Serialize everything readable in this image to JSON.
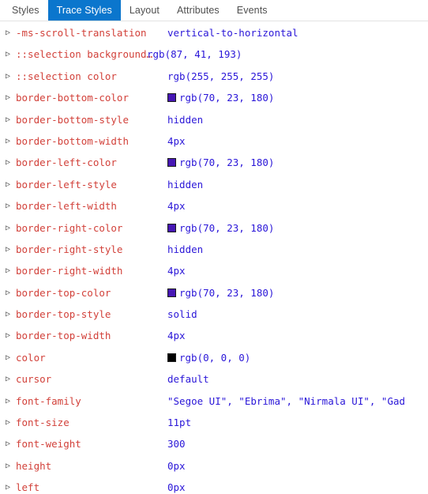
{
  "tabs": [
    {
      "label": "Styles",
      "active": false
    },
    {
      "label": "Trace Styles",
      "active": true
    },
    {
      "label": "Layout",
      "active": false
    },
    {
      "label": "Attributes",
      "active": false
    },
    {
      "label": "Events",
      "active": false
    }
  ],
  "colors": {
    "accent": "#0b76cd",
    "property_name": "#d2413a",
    "property_value": "#2a16d8",
    "tab_text": "#4f4f4f",
    "separator": "#e3e3e3"
  },
  "expander_glyph": "▷",
  "properties": [
    {
      "name": "-ms-scroll-translation",
      "value": "vertical-to-horizontal",
      "swatch": null,
      "name_truncated": false
    },
    {
      "name": "::selection background…",
      "value": "rgb(87, 41, 193)",
      "swatch": null,
      "name_truncated": true
    },
    {
      "name": "::selection color",
      "value": "rgb(255, 255, 255)",
      "swatch": null,
      "name_truncated": false
    },
    {
      "name": "border-bottom-color",
      "value": "rgb(70, 23, 180)",
      "swatch": "#4617b4",
      "name_truncated": false
    },
    {
      "name": "border-bottom-style",
      "value": "hidden",
      "swatch": null,
      "name_truncated": false
    },
    {
      "name": "border-bottom-width",
      "value": "4px",
      "swatch": null,
      "name_truncated": false
    },
    {
      "name": "border-left-color",
      "value": "rgb(70, 23, 180)",
      "swatch": "#4617b4",
      "name_truncated": false
    },
    {
      "name": "border-left-style",
      "value": "hidden",
      "swatch": null,
      "name_truncated": false
    },
    {
      "name": "border-left-width",
      "value": "4px",
      "swatch": null,
      "name_truncated": false
    },
    {
      "name": "border-right-color",
      "value": "rgb(70, 23, 180)",
      "swatch": "#4617b4",
      "name_truncated": false
    },
    {
      "name": "border-right-style",
      "value": "hidden",
      "swatch": null,
      "name_truncated": false
    },
    {
      "name": "border-right-width",
      "value": "4px",
      "swatch": null,
      "name_truncated": false
    },
    {
      "name": "border-top-color",
      "value": "rgb(70, 23, 180)",
      "swatch": "#4617b4",
      "name_truncated": false
    },
    {
      "name": "border-top-style",
      "value": "solid",
      "swatch": null,
      "name_truncated": false
    },
    {
      "name": "border-top-width",
      "value": "4px",
      "swatch": null,
      "name_truncated": false
    },
    {
      "name": "color",
      "value": "rgb(0, 0, 0)",
      "swatch": "#000000",
      "name_truncated": false
    },
    {
      "name": "cursor",
      "value": "default",
      "swatch": null,
      "name_truncated": false
    },
    {
      "name": "font-family",
      "value": "\"Segoe UI\", \"Ebrima\", \"Nirmala UI\", \"Gad",
      "swatch": null,
      "name_truncated": false
    },
    {
      "name": "font-size",
      "value": "11pt",
      "swatch": null,
      "name_truncated": false
    },
    {
      "name": "font-weight",
      "value": "300",
      "swatch": null,
      "name_truncated": false
    },
    {
      "name": "height",
      "value": "0px",
      "swatch": null,
      "name_truncated": false
    },
    {
      "name": "left",
      "value": "0px",
      "swatch": null,
      "name_truncated": false
    }
  ]
}
